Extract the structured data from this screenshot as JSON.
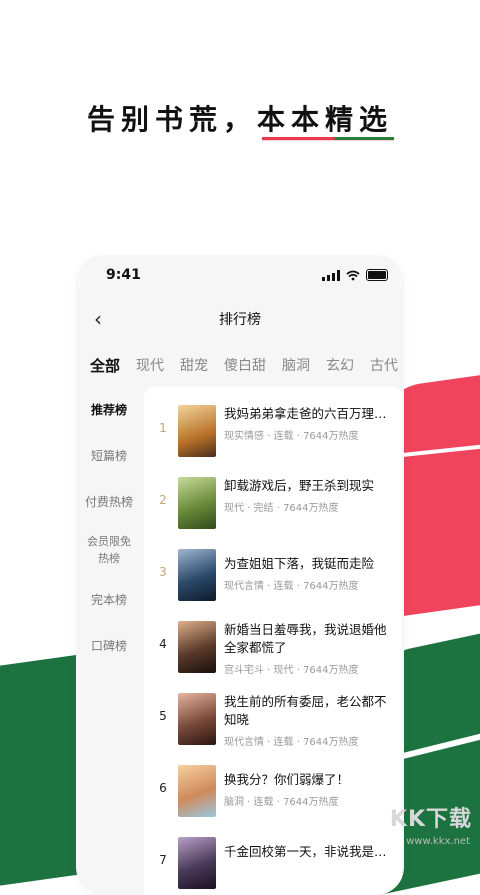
{
  "headline": "告别书荒，本本精选",
  "status": {
    "time": "9:41"
  },
  "nav": {
    "back": "‹",
    "title": "排行榜"
  },
  "tabs": [
    "全部",
    "现代",
    "甜宠",
    "傻白甜",
    "脑洞",
    "玄幻",
    "古代"
  ],
  "side": [
    "推荐榜",
    "短篇榜",
    "付费热榜",
    "会员限免热榜",
    "完本榜",
    "口碑榜"
  ],
  "books": [
    {
      "rank": "1",
      "title": "我妈弟弟拿走爸的六百万理赔…",
      "meta": "现实情感 · 连载 · 7644万热度",
      "color": "#c98a2b"
    },
    {
      "rank": "2",
      "title": "卸载游戏后，野王杀到现实",
      "meta": "现代 · 完结 · 7644万热度",
      "color": "#6a8c3a"
    },
    {
      "rank": "3",
      "title": "为查姐姐下落，我铤而走险",
      "meta": "现代言情 · 连载 · 7644万热度",
      "color": "#2b4a6a"
    },
    {
      "rank": "4",
      "title": "新婚当日羞辱我，我说退婚他全家都慌了",
      "meta": "宫斗宅斗 · 现代 · 7644万热度",
      "color": "#5a3a2a"
    },
    {
      "rank": "5",
      "title": "我生前的所有委屈，老公都不知晓",
      "meta": "现代言情 · 连载 · 7644万热度",
      "color": "#7a4a3a"
    },
    {
      "rank": "6",
      "title": "换我分？你们弱爆了！",
      "meta": "脑洞 · 连载 · 7644万热度",
      "color": "#d08a5a"
    },
    {
      "rank": "7",
      "title": "千金回校第一天，非说我是…",
      "meta": "",
      "color": "#4a3a5a"
    }
  ],
  "watermark": {
    "text": "KK下载",
    "url": "www.kkx.net"
  }
}
